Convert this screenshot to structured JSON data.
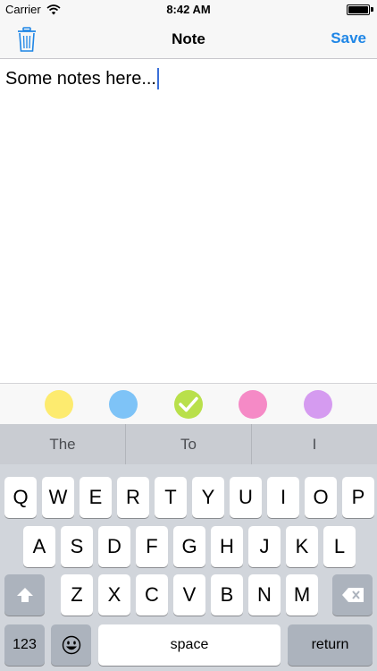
{
  "status_bar": {
    "carrier": "Carrier",
    "time": "8:42 AM"
  },
  "nav": {
    "title": "Note",
    "save_label": "Save",
    "trash_icon": "trash-icon"
  },
  "note": {
    "text": "Some notes here..."
  },
  "color_picker": {
    "swatches": [
      {
        "name": "yellow",
        "color": "#fdeb6f",
        "selected": false
      },
      {
        "name": "blue",
        "color": "#7ec3f7",
        "selected": false
      },
      {
        "name": "green",
        "color": "#b9e04b",
        "selected": true
      },
      {
        "name": "pink",
        "color": "#f58ac6",
        "selected": false
      },
      {
        "name": "purple",
        "color": "#d59bf0",
        "selected": false
      }
    ],
    "check_icon": "checkmark-icon"
  },
  "keyboard": {
    "suggestions": [
      "The",
      "To",
      "I"
    ],
    "row1": [
      "Q",
      "W",
      "E",
      "R",
      "T",
      "Y",
      "U",
      "I",
      "O",
      "P"
    ],
    "row2": [
      "A",
      "S",
      "D",
      "F",
      "G",
      "H",
      "J",
      "K",
      "L"
    ],
    "row3": [
      "Z",
      "X",
      "C",
      "V",
      "B",
      "N",
      "M"
    ],
    "numbers_label": "123",
    "space_label": "space",
    "return_label": "return",
    "shift_icon": "shift-icon",
    "delete_icon": "delete-icon",
    "emoji_icon": "emoji-icon"
  }
}
